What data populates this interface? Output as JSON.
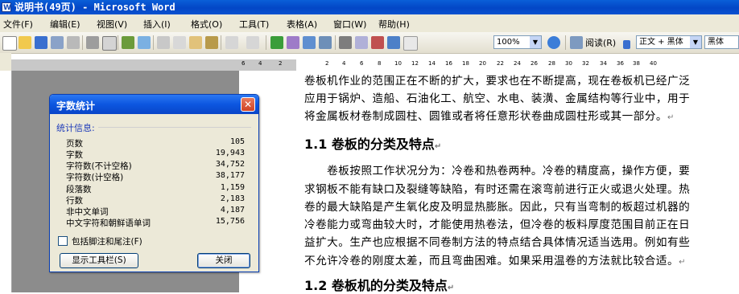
{
  "window": {
    "title": "说明书(49页) - Microsoft Word"
  },
  "menu": [
    "文件(F)",
    "编辑(E)",
    "视图(V)",
    "插入(I)",
    "格式(O)",
    "工具(T)",
    "表格(A)",
    "窗口(W)",
    "帮助(H)"
  ],
  "toolbar": {
    "zoom": "100%",
    "read_label": "阅读(R)",
    "style": "正文 + 黑体",
    "font": "黑体"
  },
  "ruler": {
    "numbers": [
      "6",
      "4",
      "2",
      "2",
      "4",
      "6",
      "8",
      "10",
      "12",
      "14",
      "16",
      "18",
      "20",
      "22",
      "24",
      "26",
      "28",
      "30",
      "32",
      "34",
      "36",
      "38",
      "40"
    ]
  },
  "document": {
    "lines": [
      "卷板机作业的范围正在不断的扩大，要求也在不断提高，现在卷板机已经广泛",
      "应用于锅炉、造船、石油化工、航空、水电、装潢、金属结构等行业中，用于",
      "将金属板材卷制成圆柱、圆锥或者将任意形状卷曲成圆柱形或其一部分。"
    ],
    "heading1": "1.1 卷板的分类及特点",
    "para2": [
      "　　卷板按照工作状况分为：冷卷和热卷两种。冷卷的精度高，操作方便，要",
      "求钢板不能有缺口及裂缝等缺陷，有时还需在滚弯前进行正火或退火处理。热",
      "卷的最大缺陷是产生氧化皮及明显热膨胀。因此，只有当弯制的板超过机器的",
      "冷卷能力或弯曲较大时，才能使用热卷法，但冷卷的板料厚度范围目前正在日",
      "益扩大。生产也应根据不同卷制方法的特点结合具体情况适当选用。例如有些",
      "不允许冷卷的刚度太差，而且弯曲困难。如果采用温卷的方法就比较合适。"
    ],
    "heading2": "1.2 卷板机的分类及特点",
    "para_mark": "↵"
  },
  "dialog": {
    "title": "字数统计",
    "close_glyph": "✕",
    "section_label": "统计信息:",
    "rows": [
      {
        "label": "页数",
        "value": "105"
      },
      {
        "label": "字数",
        "value": "19,943"
      },
      {
        "label": "字符数(不计空格)",
        "value": "34,752"
      },
      {
        "label": "字符数(计空格)",
        "value": "38,177"
      },
      {
        "label": "段落数",
        "value": "1,159"
      },
      {
        "label": "行数",
        "value": "2,183"
      },
      {
        "label": "非中文单词",
        "value": "4,187"
      },
      {
        "label": "中文字符和朝鲜语单词",
        "value": "15,756"
      }
    ],
    "checkbox_label": "包括脚注和尾注(F)",
    "show_toolbar_button": "显示工具栏(S)",
    "close_button": "关闭"
  }
}
